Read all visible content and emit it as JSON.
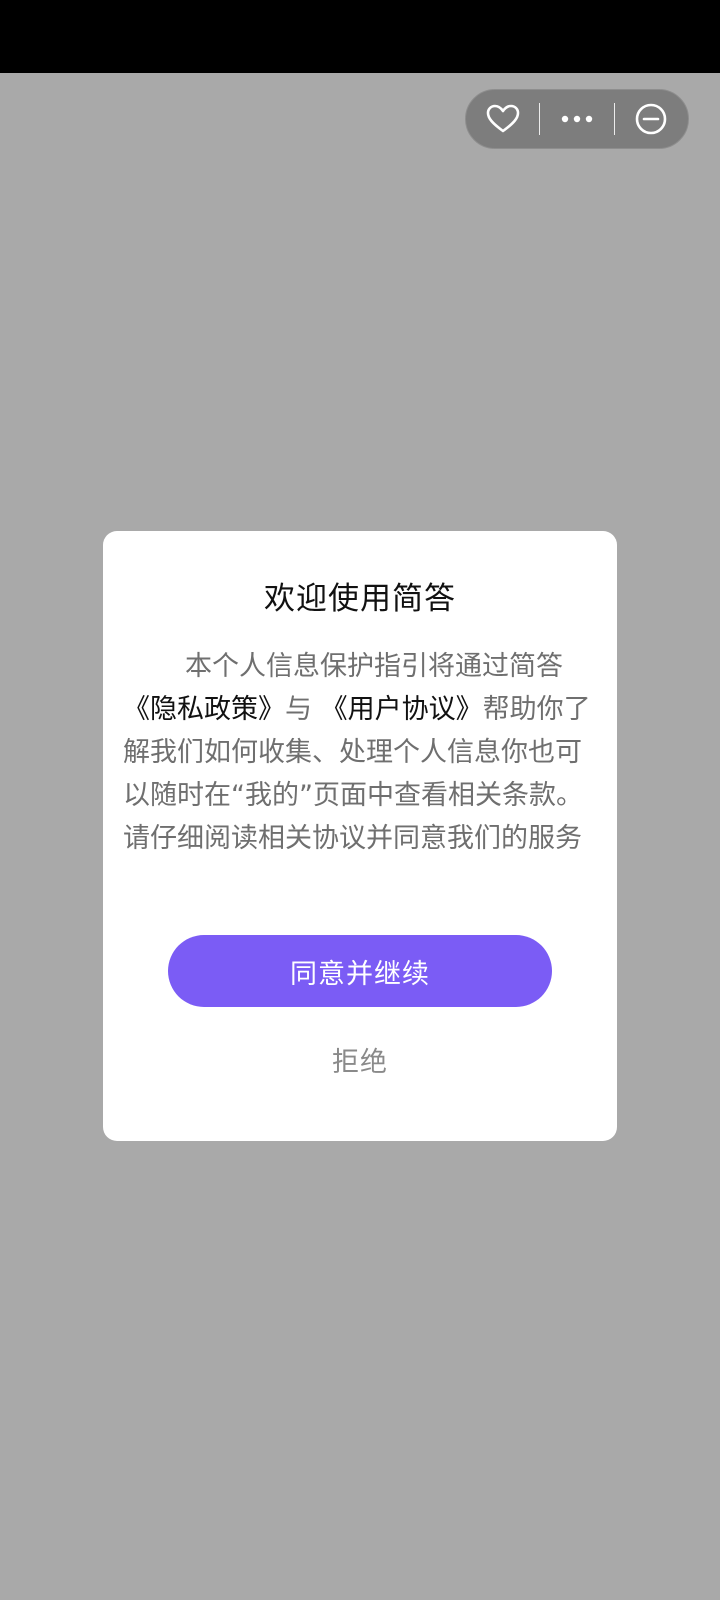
{
  "capsule": {
    "icons": [
      "heart-icon",
      "more-icon",
      "minus-circle-icon"
    ]
  },
  "dialog": {
    "title": "欢迎使用简答",
    "body": {
      "part1": "本个人信息保护指引将通过简答",
      "privacy_link": "《隐私政策》",
      "part2": "与 ",
      "agreement_link": "《用户协议》",
      "part3": "帮助你了解我们如何收集、处理个人信息你也可以随时在“我的”页面中查看相关条款。请仔细阅读相关协议并同意我们的服务"
    },
    "agree_label": "同意并继续",
    "reject_label": "拒绝"
  },
  "colors": {
    "overlay": "#a9a9a9",
    "accent": "#7b5cf5",
    "status_bar": "#000000"
  }
}
